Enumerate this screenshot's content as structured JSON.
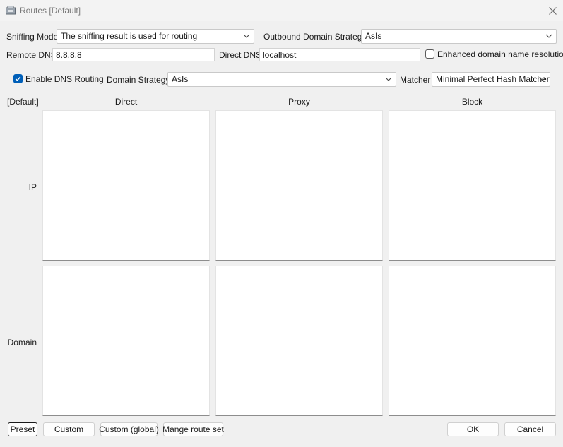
{
  "window": {
    "title": "Routes [Default]"
  },
  "row1": {
    "sniffing_label": "Sniffing Mode",
    "sniffing_value": "The sniffing result is used for routing",
    "outbound_label": "Outbound Domain Strategy",
    "outbound_value": "AsIs"
  },
  "row2": {
    "remote_dns_label": "Remote DNS",
    "remote_dns_value": "8.8.8.8",
    "direct_dns_label": "Direct DNS",
    "direct_dns_value": "localhost",
    "enhanced_label": "Enhanced domain name resolution",
    "enhanced_checked": false
  },
  "row3": {
    "enable_dns_label": "Enable DNS Routing",
    "enable_dns_checked": true,
    "domain_strategy_label": "Domain Strategy",
    "domain_strategy_value": "AsIs",
    "matcher_label": "Matcher",
    "matcher_value": "Minimal Perfect Hash Matcher"
  },
  "grid": {
    "corner_label": "[Default]",
    "columns": [
      "Direct",
      "Proxy",
      "Block"
    ],
    "rows": [
      "IP",
      "Domain"
    ]
  },
  "footer": {
    "preset_label": "Preset",
    "custom_label": "Custom",
    "custom_global_label": "Custom (global)",
    "manage_label": "Mange route set",
    "ok_label": "OK",
    "cancel_label": "Cancel"
  }
}
